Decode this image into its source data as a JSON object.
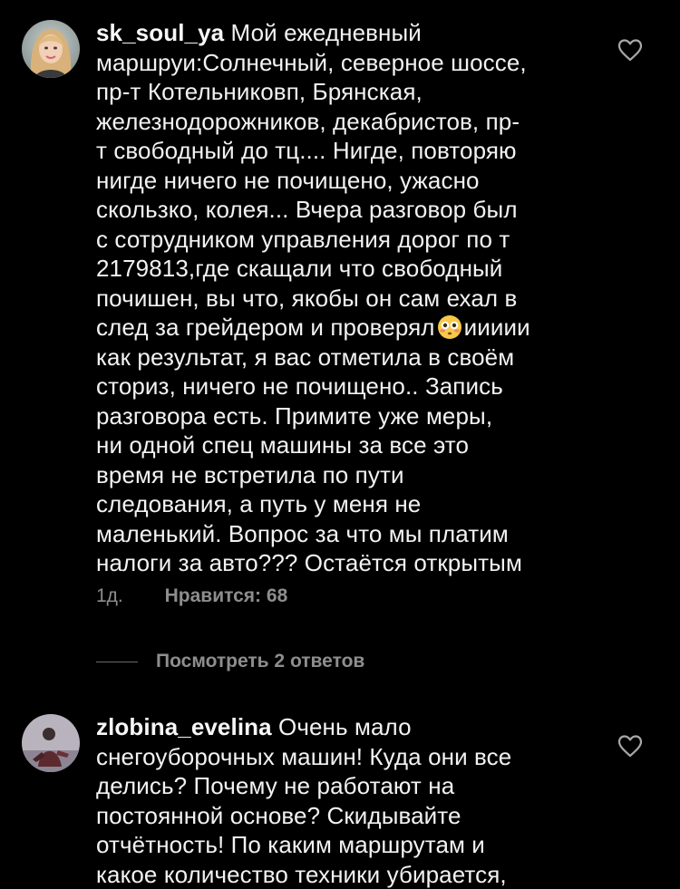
{
  "comments": [
    {
      "username": "sk_soul_ya",
      "lines": [
        "Мой ежедневный",
        "маршруи:Солнечный, северное шоссе,",
        "пр-т Котельниковп, Брянская,",
        "железнодорожников, декабристов, пр-",
        "т свободный до тц.... Нигде, повторяю",
        "нигде ничего не почищено, ужасно",
        "скользко, колея... Вчера разговор был",
        "с сотрудником управления дорог по т",
        "2179813,где скащали что свободный",
        "почишен, вы что, якобы он сам ехал в",
        "след за грейдером и проверял",
        "иииии",
        "как результат, я вас отметила в своём",
        "сториз, ничего не почищено.. Запись",
        "разговора есть. Примите уже меры,",
        "ни одной спец машины за все это",
        "время не встретила по пути",
        "следования, а путь у меня не",
        "маленький. Вопрос за что мы платим",
        "налоги за авто??? Остаётся открытым"
      ],
      "emoji": "flushed-face-emoji",
      "time": "1д.",
      "likes": "Нравится: 68",
      "view_replies": "Посмотреть 2 ответов"
    },
    {
      "username": "zlobina_evelina",
      "lines": [
        "Очень мало",
        "снегоуборочных машин! Куда они все",
        "делись? Почему не работают на",
        "постоянной основе? Скидывайте",
        "отчётность! По каким маршрутам и",
        "какое количество техники убирается,"
      ]
    }
  ],
  "icons": {
    "like": "heart-outline-icon"
  },
  "colors": {
    "background": "#000000",
    "text": "#f2f2f2",
    "muted": "#8e8e8e"
  }
}
